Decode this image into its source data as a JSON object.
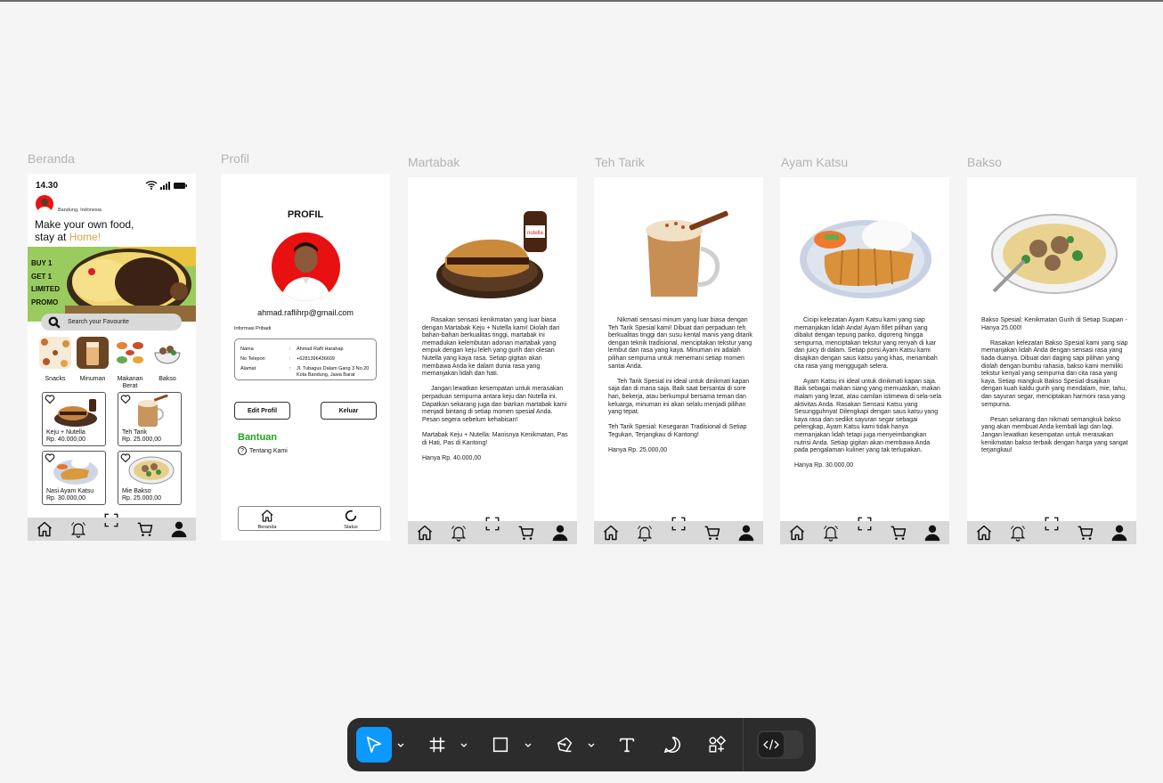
{
  "canvas": {
    "frames": [
      {
        "id": "beranda",
        "label": "Beranda"
      },
      {
        "id": "profil",
        "label": "Profil"
      },
      {
        "id": "martabak",
        "label": "Martabak"
      },
      {
        "id": "tehtarik",
        "label": "Teh Tarik"
      },
      {
        "id": "ayamkatsu",
        "label": "Ayam Katsu"
      },
      {
        "id": "bakso",
        "label": "Bakso"
      }
    ]
  },
  "beranda": {
    "time": "14.30",
    "location": "Bandung, Indonesia",
    "greeting_prefix": "Make your own food,",
    "greeting_line2": "stay at ",
    "greeting_accent": "Home!",
    "promo_lines": [
      "BUY 1",
      "GET 1",
      "LIMITED",
      "PROMO"
    ],
    "search_placeholder": "Search your Favourite",
    "categories": [
      "Snacks",
      "Minuman",
      "Makanan Berat",
      "Bakso"
    ],
    "products": [
      {
        "name": "Keju + Nutella",
        "price": "Rp. 40.000,00"
      },
      {
        "name": "Teh Tarik",
        "price": "Rp. 25.000,00"
      },
      {
        "name": "Nasi Ayam Katsu",
        "price": "Rp. 30.000,00"
      },
      {
        "name": "Mie Bakso",
        "price": "Rp. 25.000,00"
      }
    ]
  },
  "profil": {
    "title": "PROFIL",
    "email": "ahmad.raflihrp@gmail.com",
    "info_label": "Informasi Pribadi",
    "fields": [
      {
        "key": "Nama",
        "value": "Ahmad Rafli Harahap"
      },
      {
        "key": "No Telepon",
        "value": "+6281396436609"
      },
      {
        "key": "Alamat",
        "value": "Jl. Tubagus Dalam Gang 3 No.20 Kota Bandung, Jawa Barat"
      }
    ],
    "edit_button": "Edit Profil",
    "logout_button": "Keluar",
    "help_title": "Bantuan",
    "about": "Tentang Kami",
    "nav": {
      "home": "Beranda",
      "status": "Status"
    }
  },
  "details": {
    "martabak": {
      "paragraphs": [
        "Rasakan sensasi kenikmatan yang luar biasa dengan Martabak Keju + Nutella kami! Diolah dari bahan-bahan berkualitas tinggi, martabak ini memadukan kelembutan adonan martabak yang empuk dengan keju leleh yang gurih dan olesan Nutella yang kaya rasa. Setiap gigitan akan membawa Anda ke dalam dunia rasa yang memanjakan lidah dan hati.",
        "Jangan lewatkan kesempatan untuk merasakan perpaduan sempurna antara keju dan Nutella ini. Dapatkan sekarang juga dan biarkan martabak kami menjadi bintang di setiap momen spesial Anda. Pesan segera sebelum kehabisan!",
        "Martabak Keju + Nutella: Manisnya Kenikmatan, Pas di Hati, Pas di Kantong!",
        "Hanya Rp. 40.000,00"
      ]
    },
    "tehtarik": {
      "paragraphs": [
        "Nikmati sensasi minum yang luar biasa dengan Teh Tarik Spesial kami! Dibuat dari perpaduan teh berkualitas tinggi dan susu kental manis yang ditarik dengan teknik tradisional, menciptakan tekstur yang lembut dan rasa yang kaya. Minuman ini adalah pilihan sempurna untuk menemani setiap momen santai Anda.",
        "Teh Tarik Spesial ini ideal untuk dinikmati kapan saja dan di mana saja. Baik saat bersantai di sore hari, bekerja, atau berkumpul bersama teman dan keluarga, minuman ini akan selalu menjadi pilihan yang tepat.",
        "Teh Tarik Spesial: Kesegaran Tradisional di Setiap Tegukan, Terjangkau di Kantong!",
        "Hanya Rp. 25.000,00"
      ]
    },
    "ayamkatsu": {
      "paragraphs": [
        "Cicipi kelezatan Ayam Katsu kami yang siap memanjakan lidah Anda! Ayam fillet pilihan yang dibalut dengan tepung panko, digoreng hingga sempurna, menciptakan tekstur yang renyah di luar dan juicy di dalam. Setiap porsi Ayam Katsu kami disajikan dengan saus katsu yang khas, menambah cita rasa yang menggugah selera.",
        "Ayam Katsu ini ideal untuk dinikmati kapan saja. Baik sebagai makan siang yang memuaskan, makan malam yang lezat, atau camilan istimewa di sela-sela aktivitas Anda. Rasakan Sensasi Katsu yang Sesungguhnya! Dilengkapi dengan saus katsu yang kaya rasa dan sedikit sayuran segar sebagai pelengkap, Ayam Katsu kami tidak hanya memanjakan lidah tetapi juga menyeimbangkan nutrisi Anda. Setiap gigitan akan membawa Anda pada pengalaman kuliner yang tak terlupakan.",
        "Hanya Rp. 30.000,00"
      ]
    },
    "bakso": {
      "paragraphs": [
        "Bakso Spesial: Kenikmatan Gurih di Setiap Suapan - Hanya 25.000!",
        "Rasakan kelezatan Bakso Spesial kami yang siap memanjakan lidah Anda dengan sensasi rasa yang tiada duanya. Dibuat dari daging sapi pilihan yang diolah dengan bumbu rahasia, bakso kami memiliki tekstur kenyal yang sempurna dan cita rasa yang kaya. Setiap mangkuk Bakso Spesial disajikan dengan kuah kaldu gurih yang mendalam, mie, tahu, dan sayuran segar, menciptakan harmoni rasa yang sempurna.",
        "Pesan sekarang dan nikmati semangkuk bakso yang akan membuat Anda kembali lagi dan lagi. Jangan lewatkan kesempatan untuk merasakan kenikmatan bakso terbaik dengan harga yang sangat terjangkau!"
      ]
    }
  },
  "toolbar": {
    "tools": [
      "move-tool",
      "frame-tool",
      "shape-tool",
      "pen-tool",
      "text-tool",
      "comment-tool",
      "actions-tool",
      "dev-mode-toggle"
    ],
    "accent": "#0d99ff"
  }
}
